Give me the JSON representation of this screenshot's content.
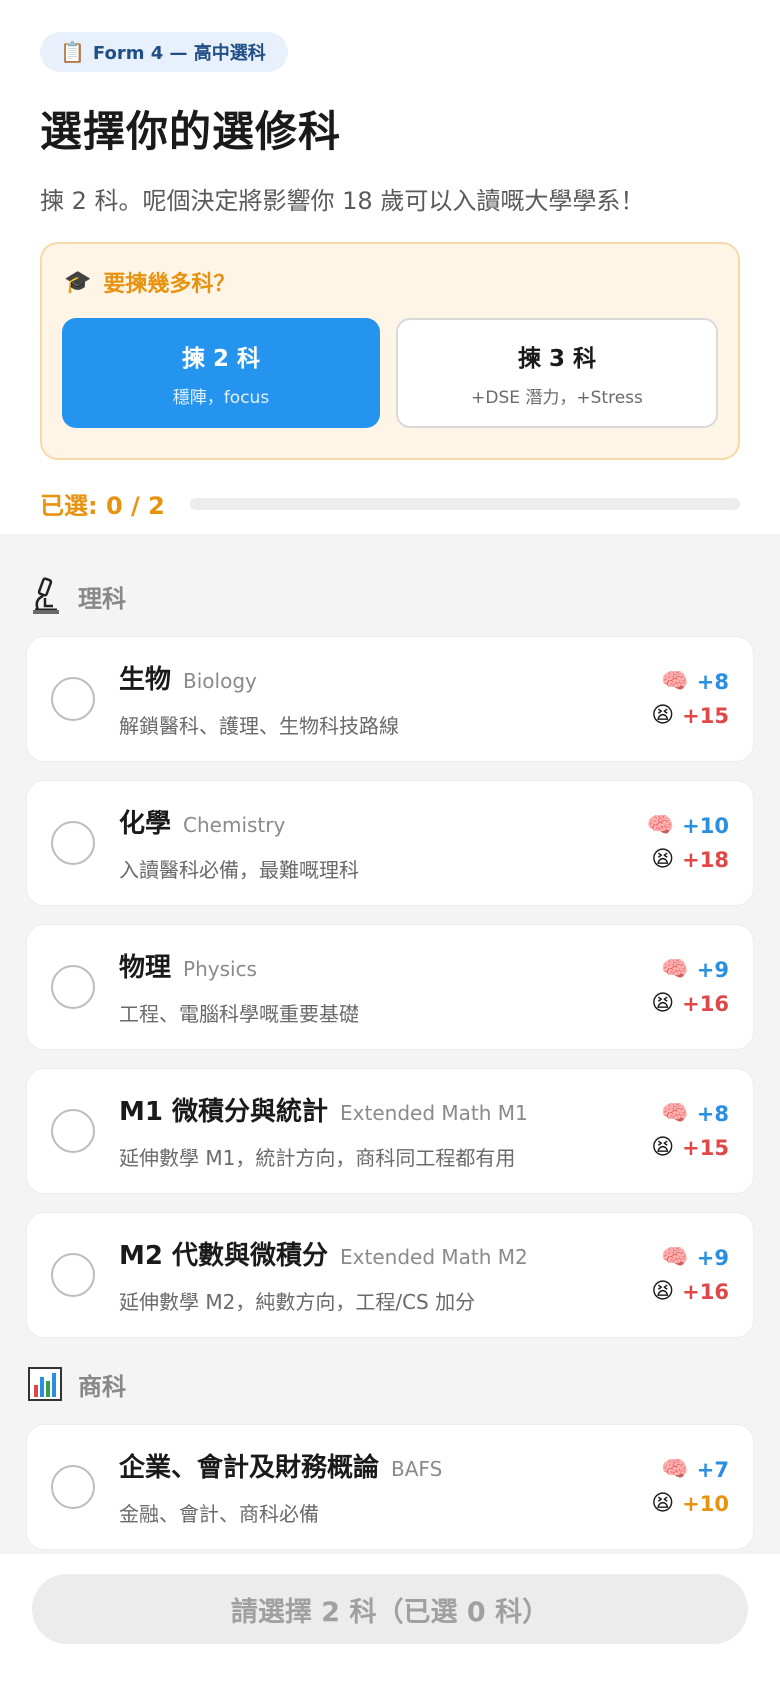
{
  "header": {
    "tag_icon": "clipboard-icon",
    "tag_label": "Form 4 — 高中選科",
    "title": "選擇你的選修科",
    "subtitle": "揀 2 科。呢個決定將影響你 18 歲可以入讀嘅大學學系！"
  },
  "count_box": {
    "heading": "要揀幾多科？",
    "options": [
      {
        "title": "揀 2 科",
        "sub": "穩陣，focus",
        "selected": true
      },
      {
        "title": "揀 3 科",
        "sub": "+DSE 潛力，+Stress",
        "selected": false
      }
    ]
  },
  "progress": {
    "label": "已選: 0 / 2",
    "fraction": 0
  },
  "categories": [
    {
      "name": "理科",
      "icon": "microscope-icon",
      "subjects": [
        {
          "cn": "生物",
          "en": "Biology",
          "desc": "解鎖醫科、護理、生物科技路線",
          "brain": "+8",
          "stress": "+15"
        },
        {
          "cn": "化學",
          "en": "Chemistry",
          "desc": "入讀醫科必備，最難嘅理科",
          "brain": "+10",
          "stress": "+18"
        },
        {
          "cn": "物理",
          "en": "Physics",
          "desc": "工程、電腦科學嘅重要基礎",
          "brain": "+9",
          "stress": "+16"
        },
        {
          "cn": "M1 微積分與統計",
          "en": "Extended Math M1",
          "desc": "延伸數學 M1，統計方向，商科同工程都有用",
          "brain": "+8",
          "stress": "+15"
        },
        {
          "cn": "M2 代數與微積分",
          "en": "Extended Math M2",
          "desc": "延伸數學 M2，純數方向，工程/CS 加分",
          "brain": "+9",
          "stress": "+16"
        }
      ]
    },
    {
      "name": "商科",
      "icon": "bar-chart-icon",
      "subjects": [
        {
          "cn": "企業、會計及財務概論",
          "en": "BAFS",
          "desc": "金融、會計、商科必備",
          "brain": "+7",
          "stress": "+10"
        }
      ]
    }
  ],
  "footer": {
    "cta_label": "請選擇 2 科（已選 0 科）"
  },
  "colors": {
    "accent": "#2594ef",
    "warning": "#e8930f",
    "stress": "#e04848",
    "brain": "#2a8fe0"
  }
}
